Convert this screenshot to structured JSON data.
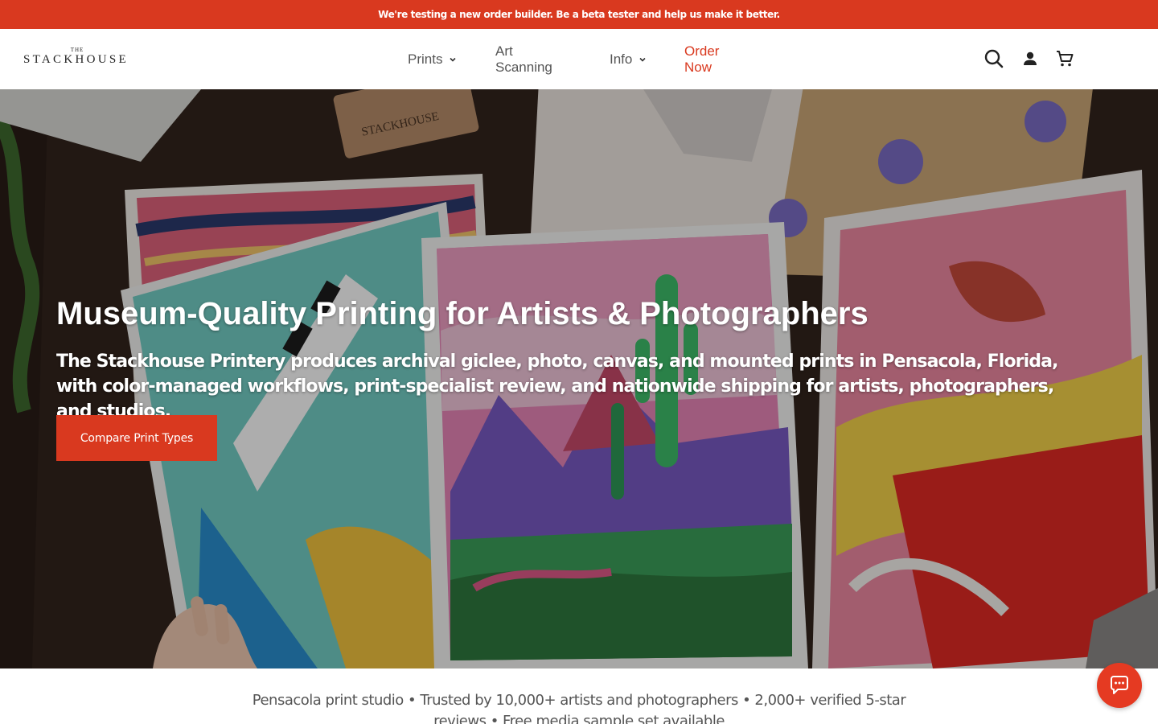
{
  "announcement": {
    "text": "We're testing a new order builder. Be a beta tester and help us make it better."
  },
  "header": {
    "logo": {
      "small": "THE",
      "main": "STACKHOUSE"
    },
    "nav": [
      {
        "label": "Prints",
        "has_dropdown": true
      },
      {
        "label": "Art Scanning",
        "has_dropdown": false
      },
      {
        "label": "Info",
        "has_dropdown": true
      },
      {
        "label": "Order Now",
        "has_dropdown": false
      }
    ],
    "icons": [
      "search-icon",
      "account-icon",
      "cart-icon"
    ]
  },
  "hero": {
    "title": "Museum-Quality Printing for Artists & Photographers",
    "subtitle": "The Stackhouse Printery produces archival giclee, photo, canvas, and mounted prints in Pensacola, Florida, with color-managed workflows, print-specialist review, and nationwide shipping for artists, photographers, and studios.",
    "cta_label": "Compare Print Types",
    "background_text": "STACKHOUSE"
  },
  "trust_bar": {
    "text": "Pensacola print studio • Trusted by 10,000+ artists and photographers • 2,000+ verified 5-star reviews • Free media sample set available"
  },
  "chat": {
    "icon": "chat-icon"
  },
  "colors": {
    "accent": "#d9391f",
    "nav_text": "#555555",
    "order_now": "#d9391f",
    "white": "#ffffff"
  }
}
